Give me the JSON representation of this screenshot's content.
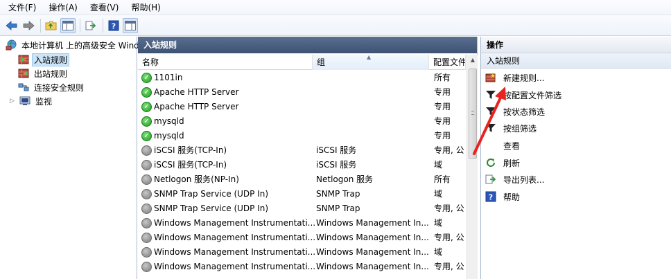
{
  "menu": [
    "文件(F)",
    "操作(A)",
    "查看(V)",
    "帮助(H)"
  ],
  "toolbar": {
    "icons": [
      "back-icon",
      "forward-icon",
      "up-folder-icon",
      "show-hide-tree-icon",
      "export-list-icon",
      "help-icon",
      "show-hide-action-pane-icon"
    ]
  },
  "tree": {
    "root": "本地计算机 上的高级安全 Wind",
    "items": [
      "入站规则",
      "出站规则",
      "连接安全规则",
      "监视"
    ]
  },
  "middle": {
    "title": "入站规则",
    "columns": [
      "名称",
      "组",
      "配置文件"
    ],
    "rows": [
      {
        "name": "1101in",
        "group": "",
        "profile": "所有",
        "enabled": true
      },
      {
        "name": "Apache HTTP Server",
        "group": "",
        "profile": "专用",
        "enabled": true
      },
      {
        "name": "Apache HTTP Server",
        "group": "",
        "profile": "专用",
        "enabled": true
      },
      {
        "name": "mysqld",
        "group": "",
        "profile": "专用",
        "enabled": true
      },
      {
        "name": "mysqld",
        "group": "",
        "profile": "专用",
        "enabled": true
      },
      {
        "name": "iSCSI 服务(TCP-In)",
        "group": "iSCSI 服务",
        "profile": "专用, 公",
        "enabled": false
      },
      {
        "name": "iSCSI 服务(TCP-In)",
        "group": "iSCSI 服务",
        "profile": "域",
        "enabled": false
      },
      {
        "name": "Netlogon 服务(NP-In)",
        "group": "Netlogon 服务",
        "profile": "所有",
        "enabled": false
      },
      {
        "name": "SNMP Trap Service (UDP In)",
        "group": "SNMP Trap",
        "profile": "域",
        "enabled": false
      },
      {
        "name": "SNMP Trap Service (UDP In)",
        "group": "SNMP Trap",
        "profile": "专用, 公",
        "enabled": false
      },
      {
        "name": "Windows Management Instrumentati...",
        "group": "Windows Management In...",
        "profile": "域",
        "enabled": false
      },
      {
        "name": "Windows Management Instrumentati...",
        "group": "Windows Management In...",
        "profile": "专用, 公",
        "enabled": false
      },
      {
        "name": "Windows Management Instrumentati...",
        "group": "Windows Management In...",
        "profile": "域",
        "enabled": false
      },
      {
        "name": "Windows Management Instrumentati...",
        "group": "Windows Management In...",
        "profile": "专用, 公",
        "enabled": false
      }
    ]
  },
  "actions": {
    "title": "操作",
    "section": "入站规则",
    "items": [
      {
        "label": "新建规则...",
        "icon": "new-rule-icon"
      },
      {
        "label": "按配置文件筛选",
        "icon": "filter-icon"
      },
      {
        "label": "按状态筛选",
        "icon": "filter-icon"
      },
      {
        "label": "按组筛选",
        "icon": "filter-icon"
      },
      {
        "label": "查看",
        "icon": ""
      },
      {
        "label": "刷新",
        "icon": "refresh-icon"
      },
      {
        "label": "导出列表...",
        "icon": "export-list-icon"
      },
      {
        "label": "帮助",
        "icon": "help-icon"
      }
    ]
  },
  "colors": {
    "annotation_arrow": "#e8231f",
    "pane_title": "#4a5e80",
    "enabled_rule": "#2aa52a",
    "selection": "#cce4f7"
  }
}
